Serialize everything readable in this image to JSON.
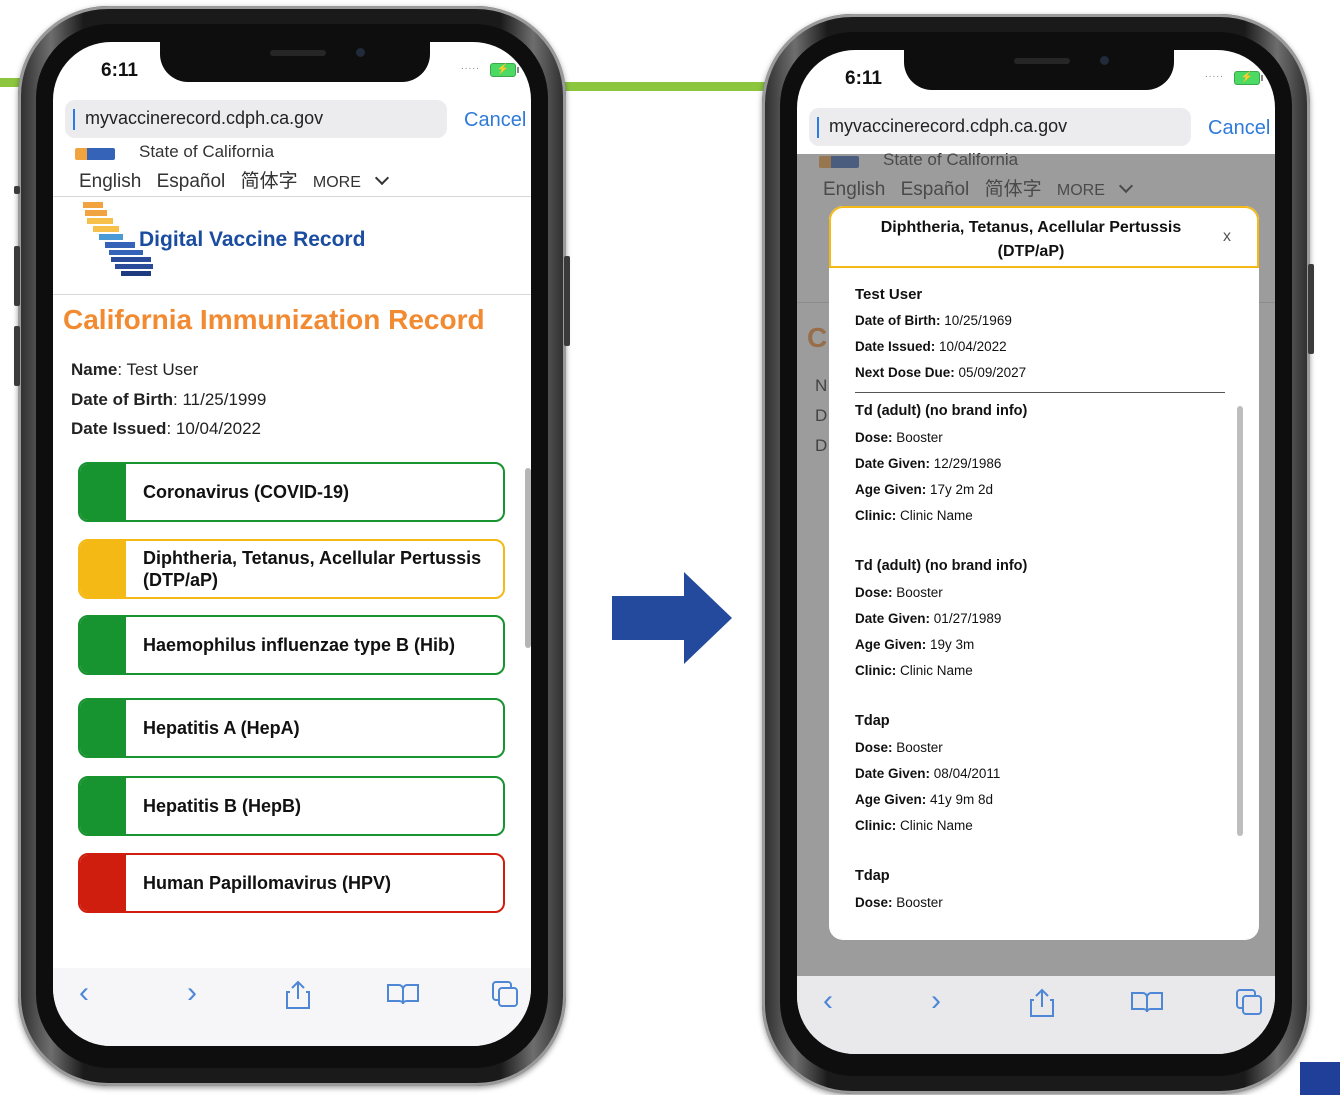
{
  "colors": {
    "green": "#17932f",
    "amber": "#f5b915",
    "red": "#d01e0e",
    "accent": "#2f7bd8",
    "orange": "#f28a32",
    "brand_blue": "#1a4ca0"
  },
  "status_bar": {
    "time": "6:11",
    "signal": ".....",
    "battery_icon": "battery-charging-icon"
  },
  "browser": {
    "url": "myvaccinerecord.cdph.ca.gov",
    "cancel_label": "Cancel"
  },
  "site": {
    "state_label": "State of California",
    "languages": [
      "English",
      "Español",
      "简体字"
    ],
    "more_label": "MORE",
    "logo_title": "Digital Vaccine Record"
  },
  "left": {
    "record_title": "California Immunization Record",
    "name_label": "Name",
    "name_value": "Test User",
    "dob_label": "Date of Birth",
    "dob_value": "11/25/1999",
    "issued_label": "Date Issued",
    "issued_value": "10/04/2022",
    "vaccines": [
      {
        "label": "Coronavirus (COVID-19)",
        "status": "green"
      },
      {
        "label": "Diphtheria, Tetanus, Acellular Pertussis (DTP/aP)",
        "status": "amber"
      },
      {
        "label": "Haemophilus influenzae type B (Hib)",
        "status": "green"
      },
      {
        "label": "Hepatitis A (HepA)",
        "status": "green"
      },
      {
        "label": "Hepatitis B (HepB)",
        "status": "green"
      },
      {
        "label": "Human Papillomavirus (HPV)",
        "status": "red"
      }
    ]
  },
  "right": {
    "bg_title_initial": "C",
    "bg_letters": [
      "N",
      "D",
      "D"
    ],
    "modal": {
      "title": "Diphtheria, Tetanus, Acellular Pertussis (DTP/aP)",
      "close": "x",
      "patient": "Test User",
      "dob_label": "Date of Birth:",
      "dob_value": "10/25/1969",
      "issued_label": "Date Issued:",
      "issued_value": "10/04/2022",
      "next_label": "Next Dose Due:",
      "next_value": "05/09/2027",
      "doses": [
        {
          "name": "Td (adult) (no brand info)",
          "dose": "Booster",
          "date_given": "12/29/1986",
          "age_given": "17y 2m 2d",
          "clinic": "Clinic Name"
        },
        {
          "name": "Td (adult) (no brand info)",
          "dose": "Booster",
          "date_given": "01/27/1989",
          "age_given": "19y 3m",
          "clinic": "Clinic Name"
        },
        {
          "name": "Tdap",
          "dose": "Booster",
          "date_given": "08/04/2011",
          "age_given": "41y 9m 8d",
          "clinic": "Clinic Name"
        },
        {
          "name": "Tdap",
          "dose": "Booster"
        }
      ],
      "labels": {
        "dose": "Dose:",
        "date_given": "Date Given:",
        "age_given": "Age Given:",
        "clinic": "Clinic:"
      }
    }
  },
  "toolbar": {
    "back": "‹",
    "forward": "›",
    "icons": [
      "back-icon",
      "forward-icon",
      "share-icon",
      "bookmarks-icon",
      "tabs-icon"
    ]
  }
}
